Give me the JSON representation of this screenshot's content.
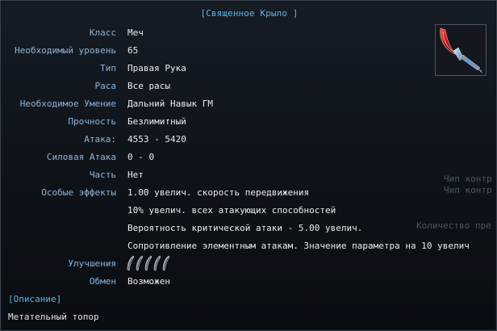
{
  "item": {
    "title": "[Священное Крыло ]",
    "attributes": [
      {
        "label": "Класс",
        "value": "Меч"
      },
      {
        "label": "Необходимый уровень",
        "value": "65"
      },
      {
        "label": "Тип",
        "value": "Правая Рука"
      },
      {
        "label": "Раса",
        "value": "Все расы"
      },
      {
        "label": "Необходимое Умение",
        "value": "Дальний Навык ГМ"
      },
      {
        "label": "Прочность",
        "value": "Безлимитный"
      },
      {
        "label": "Атака:",
        "value": "4553 - 5420"
      },
      {
        "label": "Силовая Атака",
        "value": "0 - 0"
      },
      {
        "label": "Часть",
        "value": "Нет"
      }
    ],
    "special_effects": {
      "label": "Особые эффекты",
      "lines": [
        "1.00 увелич. скорость передвижения",
        "10% увелич. всех атакующих способностей",
        "Вероятность критической атаки - 5.00 увелич.",
        "Сопротивление элементным атакам. Значение параметра на 10 увелич"
      ]
    },
    "upgrades": {
      "label": "Улучшения",
      "slot_count": 5,
      "slot_icon": "feather-gem-icon"
    },
    "exchange": {
      "label": "Обмен",
      "value": "Возможен"
    },
    "description": {
      "header": "[Описание]",
      "text": "Метательный топор"
    },
    "icon": "curved-blade-sword-icon"
  },
  "background_text": {
    "line1": "Чип контр",
    "line2": "Чип контр",
    "line3": "Количество пре"
  },
  "colors": {
    "title": "#5fb3e6",
    "label": "#8fb4d8",
    "value": "#ececec"
  }
}
